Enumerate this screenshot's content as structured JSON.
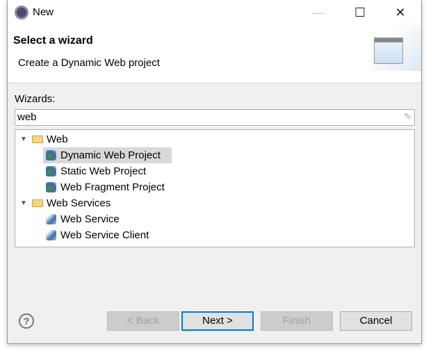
{
  "window": {
    "title": "New",
    "minimize": "—",
    "maximize": "☐",
    "close": "✕"
  },
  "header": {
    "title": "Select a wizard",
    "description": "Create a Dynamic Web project"
  },
  "wizards_label": "Wizards:",
  "search": {
    "value": "web",
    "clear_icon": "eraser-icon"
  },
  "tree": [
    {
      "label": "Web",
      "expanded": true,
      "children": [
        {
          "label": "Dynamic Web Project",
          "selected": true
        },
        {
          "label": "Static Web Project"
        },
        {
          "label": "Web Fragment Project"
        }
      ]
    },
    {
      "label": "Web Services",
      "expanded": true,
      "children": [
        {
          "label": "Web Service"
        },
        {
          "label": "Web Service Client"
        }
      ]
    }
  ],
  "buttons": {
    "help": "?",
    "back": "< Back",
    "next": "Next >",
    "finish": "Finish",
    "cancel": "Cancel"
  }
}
